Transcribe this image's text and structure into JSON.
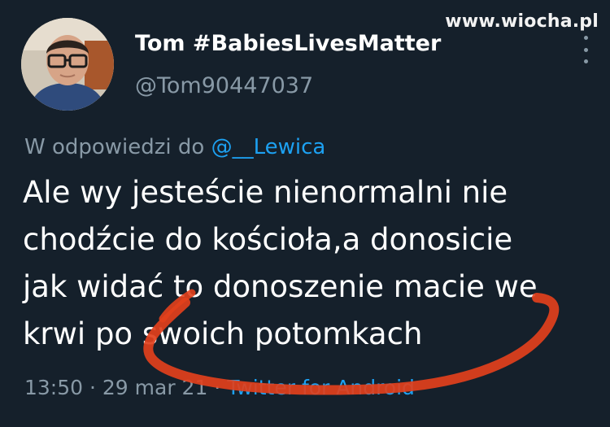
{
  "watermark": "www.wiocha.pl",
  "author": {
    "display_name": "Tom #BabiesLivesMatter",
    "handle": "@Tom90447037"
  },
  "reply": {
    "prefix": "W odpowiedzi do ",
    "mention": "@__Lewica"
  },
  "tweet": {
    "lines": [
      "Ale wy jesteście nienormalni nie",
      "chodźcie do kościoła,a donosicie",
      "jak widać to donoszenie macie we",
      "krwi po swoich potomkach"
    ]
  },
  "meta": {
    "time": "13:50",
    "separator": " · ",
    "date": "29 mar 21",
    "source": "Twitter for Android"
  },
  "colors": {
    "background": "#15202b",
    "secondary_text": "#8899a6",
    "link": "#1da1f2",
    "annotation_stroke": "#e2401c"
  },
  "icons": {
    "more": "more-vertical-icon",
    "avatar": "profile-photo"
  }
}
